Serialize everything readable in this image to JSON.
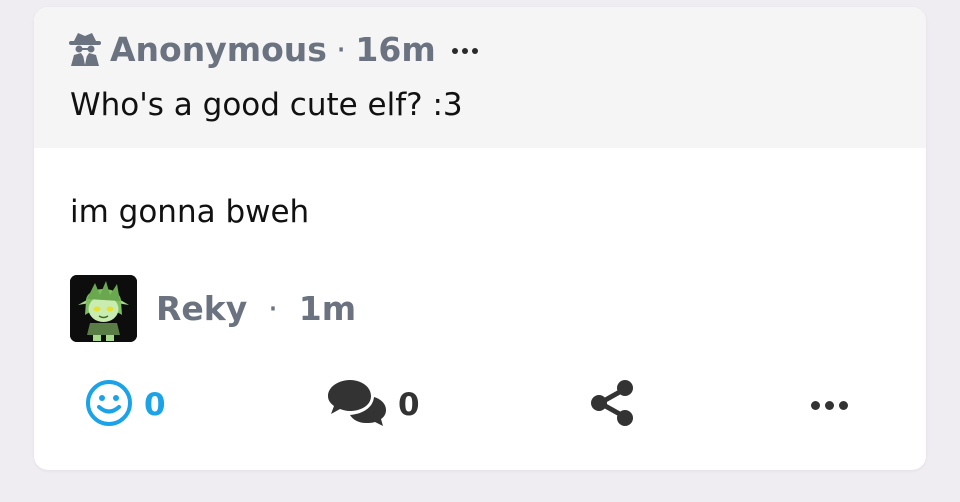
{
  "quote": {
    "author": "Anonymous",
    "separator": "·",
    "time": "16m",
    "text": "Who's a good cute elf? :3",
    "author_icon": "spy-icon",
    "more_icon": "more-dots-icon"
  },
  "reply": {
    "text": "im gonna bweh",
    "author": "Reky",
    "separator": "·",
    "time": "1m"
  },
  "actions": {
    "react_count": "0",
    "comment_count": "0",
    "react_icon": "smiley-icon",
    "comment_icon": "comments-icon",
    "share_icon": "share-icon",
    "more_icon": "more-dots-icon"
  },
  "colors": {
    "accent": "#1aa3e8",
    "meta_gray": "#6b7380",
    "background": "#efedf2",
    "quote_bg": "#f5f5f6"
  }
}
